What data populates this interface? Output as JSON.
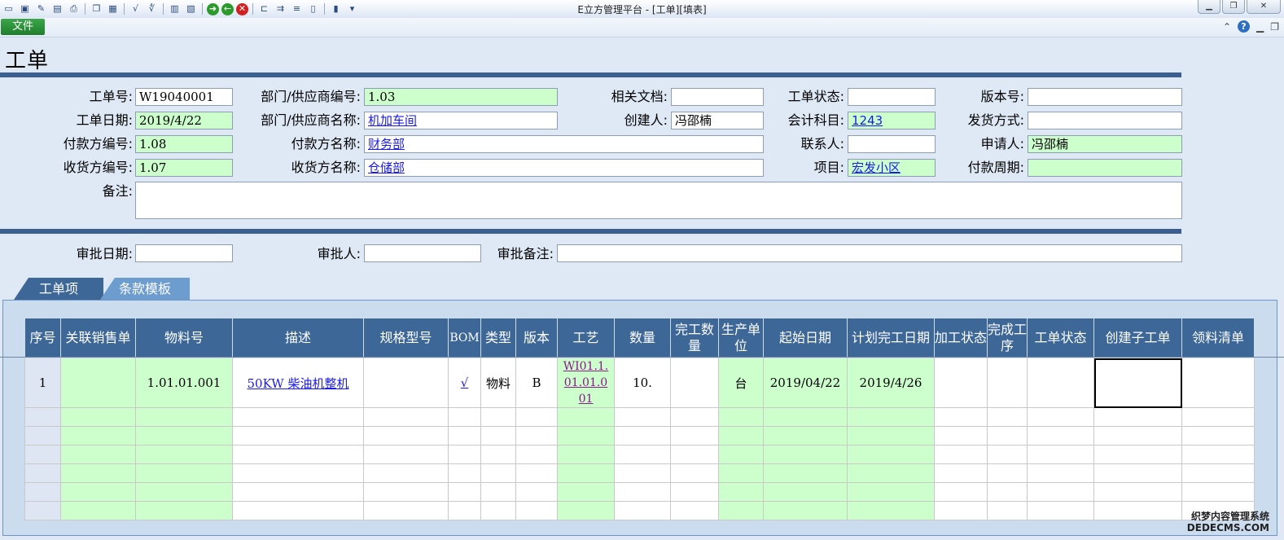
{
  "window": {
    "title": "E立方管理平台 - [工单][填表]",
    "toolbar_icons": [
      "new-icon",
      "save-icon",
      "edit-icon",
      "preview-icon",
      "print-icon",
      "copy-icon",
      "paste-icon",
      "formula-icon",
      "formula2-icon",
      "clipboard-icon",
      "export-icon",
      "go-icon",
      "back-icon",
      "stop-icon",
      "split-icon",
      "merge-icon",
      "align-icon",
      "column-icon",
      "exit-icon",
      "dropdown-icon"
    ]
  },
  "menu": {
    "file_label": "文件"
  },
  "page": {
    "title": "工单"
  },
  "form": {
    "order_no": {
      "label": "工单号:",
      "value": "W19040001"
    },
    "order_date": {
      "label": "工单日期:",
      "value": "2019/4/22"
    },
    "payer_code": {
      "label": "付款方编号:",
      "value": "1.08"
    },
    "receiver_code": {
      "label": "收货方编号:",
      "value": "1.07"
    },
    "remark": {
      "label": "备注:",
      "value": ""
    },
    "dept_code": {
      "label": "部门/供应商编号:",
      "value": "1.03"
    },
    "dept_name": {
      "label": "部门/供应商名称:",
      "value": "机加车间"
    },
    "payer_name": {
      "label": "付款方名称:",
      "value": "财务部"
    },
    "receiver_name": {
      "label": "收货方名称:",
      "value": "仓储部"
    },
    "related_doc": {
      "label": "相关文档:",
      "value": ""
    },
    "creator": {
      "label": "创建人:",
      "value": "冯邵楠"
    },
    "order_status": {
      "label": "工单状态:",
      "value": ""
    },
    "account": {
      "label": "会计科目:",
      "value": "1243"
    },
    "contact": {
      "label": "联系人:",
      "value": ""
    },
    "project": {
      "label": "项目:",
      "value": "宏发小区"
    },
    "version": {
      "label": "版本号:",
      "value": ""
    },
    "ship_method": {
      "label": "发货方式:",
      "value": ""
    },
    "applicant": {
      "label": "申请人:",
      "value": "冯邵楠"
    },
    "pay_period": {
      "label": "付款周期:",
      "value": ""
    }
  },
  "approval": {
    "date": {
      "label": "审批日期:",
      "value": ""
    },
    "approver": {
      "label": "审批人:",
      "value": ""
    },
    "note": {
      "label": "审批备注:",
      "value": ""
    }
  },
  "tabs": [
    {
      "label": "工单项"
    },
    {
      "label": "条款模板"
    }
  ],
  "grid": {
    "headers": [
      "序号",
      "关联销售单",
      "物料号",
      "描述",
      "规格型号",
      "BOM",
      "类型",
      "版本",
      "工艺",
      "数量",
      "完工数量",
      "生产单位",
      "起始日期",
      "计划完工日期",
      "加工状态",
      "完成工序",
      "工单状态",
      "创建子工单",
      "领料清单"
    ],
    "row": {
      "seq": "1",
      "sales_order": "",
      "material_no": "1.01.01.001",
      "description": "50KW 柴油机整机",
      "spec": "",
      "bom": "√",
      "type": "物料",
      "version": "B",
      "process_l1": "WI01.1.",
      "process_l2": "01.01.0",
      "process_l3": "01",
      "qty": "10.",
      "done_qty": "",
      "unit": "台",
      "start_date": "2019/04/22",
      "plan_date": "2019/4/26"
    }
  },
  "watermark": {
    "line1": "织梦内容管理系统",
    "line2": "DEDECMS.COM"
  }
}
